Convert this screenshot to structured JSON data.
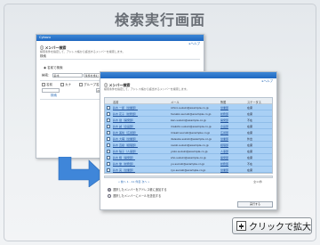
{
  "page": {
    "title": "検索実行画面"
  },
  "back_window": {
    "logo": "Cybozu",
    "help": "▸ヘルプ",
    "title": "ⓘ メンバー検索",
    "desc": "検索条件を指定して、アドレス帳から該当するメンバーを検索します。",
    "section": "検索",
    "option": "◉ 名前で検索",
    "row1_label": "検索：",
    "row1_value": "鈴木",
    "row1_mode": "条件を含む",
    "row2_items": [
      "名前",
      "カナ",
      "グループ名",
      "グループ名"
    ],
    "date_label": "2012/05/01",
    "link": "検索"
  },
  "front_window": {
    "help": "▸ヘルプ",
    "title": "ⓘ メンバー検索",
    "desc": "検索条件を指定して、アドレス帳から該当するメンバーを検索します。",
    "columns": [
      "名前",
      "メール",
      "所属",
      "ステータス"
    ],
    "rows": [
      {
        "name": "鈴木 一郎（営業部）",
        "mail": "ichiro.suzuki@example.co.jp",
        "dept": "営業部",
        "status": "在席"
      },
      {
        "name": "鈴木 花子（総務部）",
        "mail": "hanako.suzuki@example.co.jp",
        "dept": "総務部",
        "status": "在席"
      },
      {
        "name": "鈴木 健（開発部）",
        "mail": "ken.suzuki@example.co.jp",
        "dept": "開発部",
        "status": "不在"
      },
      {
        "name": "鈴木 誠（企画部）",
        "mail": "makoto.suzuki@example.co.jp",
        "dept": "企画部",
        "status": "在席"
      },
      {
        "name": "鈴木 美咲（広報部）",
        "mail": "misaki.suzuki@example.co.jp",
        "dept": "広報部",
        "status": "在席"
      },
      {
        "name": "鈴木 大輔（営業部）",
        "mail": "daisuke.suzuki@example.co.jp",
        "dept": "営業部",
        "status": "外出"
      },
      {
        "name": "鈴木 直樹（経理部）",
        "mail": "naoki.suzuki@example.co.jp",
        "dept": "経理部",
        "status": "在席"
      },
      {
        "name": "鈴木 陽子（人事部）",
        "mail": "yoko.suzuki@example.co.jp",
        "dept": "人事部",
        "status": "在席"
      },
      {
        "name": "鈴木 翔（開発部）",
        "mail": "sho.suzuki@example.co.jp",
        "dept": "開発部",
        "status": "在席"
      },
      {
        "name": "鈴木 優（総務部）",
        "mail": "yu.suzuki@example.co.jp",
        "dept": "総務部",
        "status": "不在"
      },
      {
        "name": "鈴木 亮（営業部）",
        "mail": "ryo.suzuki@example.co.jp",
        "dept": "営業部",
        "status": "在席"
      }
    ],
    "pager_left": "« 前へ  1 - 11 件目  次へ »",
    "pager_right": "全11件",
    "radio1": "選択したメンバーをアドレス帳に追加する",
    "radio2": "選択したメンバーにメールを送信する",
    "button": "実行する"
  },
  "zoom": {
    "label": "クリックで拡大"
  }
}
